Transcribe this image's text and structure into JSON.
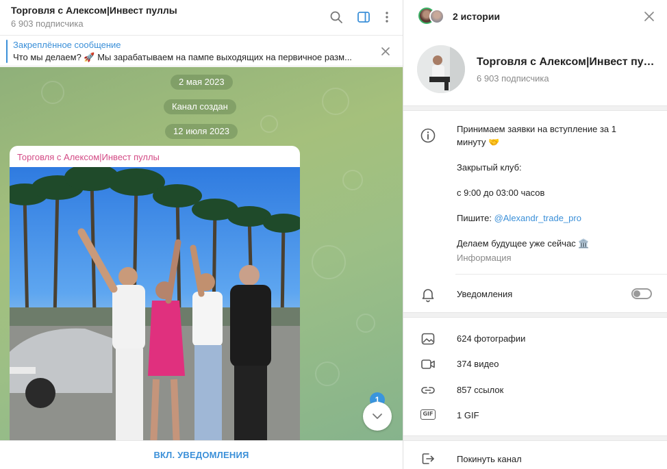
{
  "chat": {
    "title": "Торговля с Алексом|Инвест пуллы",
    "subscribers": "6 903 подписчика",
    "pinned": {
      "title": "Закреплённое сообщение",
      "text": "Что мы делаем? 🚀  Мы зарабатываем на пампе выходящих на первичное разм..."
    },
    "date_pills": [
      "2 мая 2023",
      "Канал создан",
      "12 июля 2023"
    ],
    "message": {
      "author": "Торговля с Алексом|Инвест пуллы"
    },
    "unread_count": "1",
    "bottom_action": "ВКЛ. УВЕДОМЛЕНИЯ"
  },
  "info": {
    "stories_label": "2 истории",
    "name": "Торговля с Алексом|Инвест пуллы",
    "subscribers": "6 903 подписчика",
    "description": {
      "line1": "Принимаем заявки на вступление за 1",
      "line2": "минуту 🤝",
      "line3": "Закрытый клуб:",
      "line4": " с 9:00 до 03:00 часов",
      "line5_prefix": "Пишите: ",
      "line5_link": "@Alexandr_trade_pro",
      "line6": "Делаем будущее уже сейчас 🏛️",
      "caption": "Информация"
    },
    "notifications": {
      "label": "Уведомления",
      "enabled": false
    },
    "media": {
      "photos": "624 фотографии",
      "videos": "374 видео",
      "links": "857 ссылок",
      "gifs": "1 GIF",
      "gif_badge": "GIF"
    },
    "leave": "Покинуть канал"
  },
  "colors": {
    "accent": "#3a8fd8",
    "author": "#d34a85",
    "wallpaper": "#9cbf86",
    "story_ring": "#3bb266"
  }
}
